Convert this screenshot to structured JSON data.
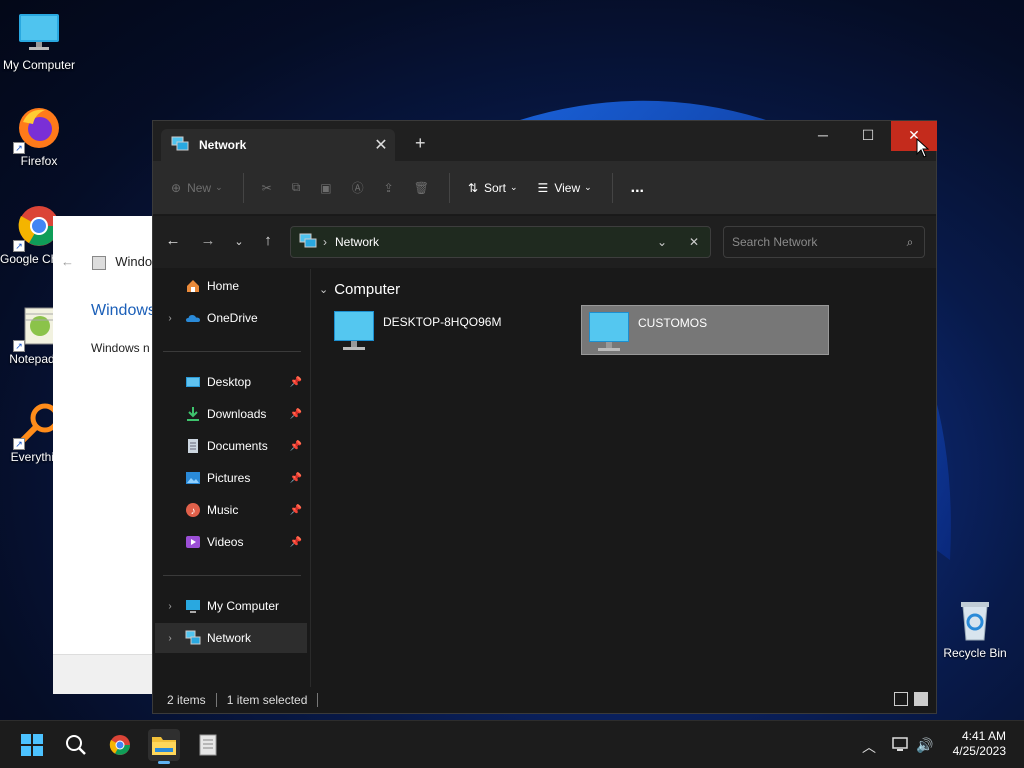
{
  "desktop": {
    "icons": [
      {
        "label": "My Computer"
      },
      {
        "label": "Firefox"
      },
      {
        "label": "Google Chrome"
      },
      {
        "label": "Notepad++"
      },
      {
        "label": "Everything"
      },
      {
        "label": "Recycle Bin"
      }
    ]
  },
  "background_window": {
    "header_text": "Windows",
    "title": "Windows",
    "body": "Windows n"
  },
  "explorer": {
    "tab_title": "Network",
    "toolbar": {
      "new_label": "New",
      "sort_label": "Sort",
      "view_label": "View",
      "more_label": "..."
    },
    "address": {
      "location": "Network"
    },
    "search": {
      "placeholder": "Search Network"
    },
    "sidebar": {
      "home": "Home",
      "onedrive": "OneDrive",
      "desktop": "Desktop",
      "downloads": "Downloads",
      "documents": "Documents",
      "pictures": "Pictures",
      "music": "Music",
      "videos": "Videos",
      "my_computer": "My Computer",
      "network": "Network"
    },
    "content": {
      "group": "Computer",
      "items": [
        {
          "name": "DESKTOP-8HQO96M",
          "selected": false
        },
        {
          "name": "CUSTOMOS",
          "selected": true
        }
      ]
    },
    "status": {
      "count": "2 items",
      "selection": "1 item selected"
    }
  },
  "taskbar": {
    "time": "4:41 AM",
    "date": "4/25/2023"
  },
  "colors": {
    "close_button": "#c42b1c",
    "accent": "#5fb2f2",
    "selection": "#777777"
  }
}
